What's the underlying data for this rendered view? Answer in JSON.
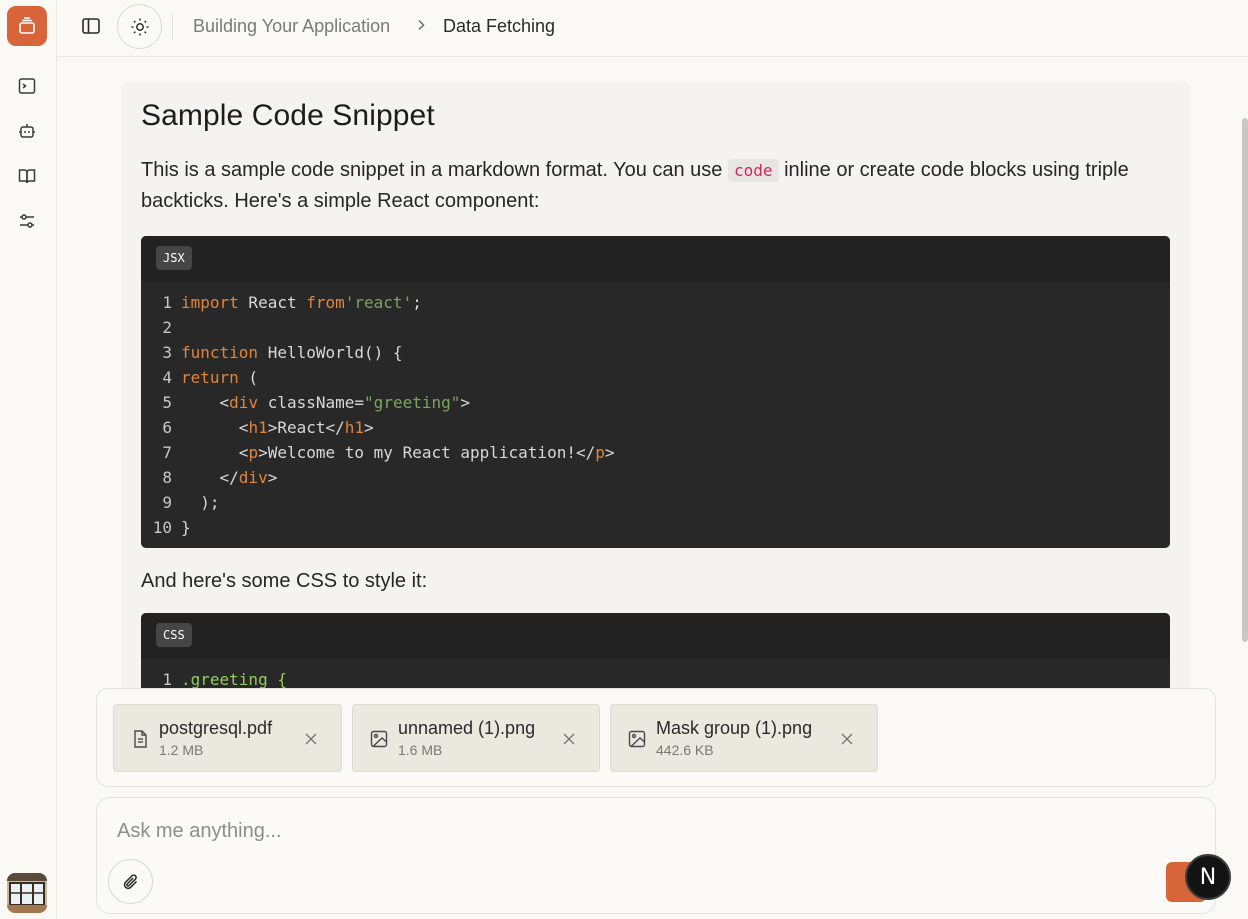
{
  "header": {
    "breadcrumb": [
      "Building Your Application",
      "Data Fetching"
    ]
  },
  "rail": {
    "items": [
      "terminal-icon",
      "bot-icon",
      "book-icon",
      "sliders-icon"
    ]
  },
  "card": {
    "title": "Sample Code Snippet",
    "intro_before": "This is a sample code snippet in a markdown format. You can use ",
    "inline_code": "code",
    "intro_after": " inline or create code blocks using triple backticks. Here's a simple React component:",
    "jsx_lang": "JSX",
    "middle_text": "And here's some CSS to style it:",
    "css_lang": "CSS",
    "css_first_line_number": "1",
    "css_first_line": ".greeting {"
  },
  "attachments": [
    {
      "name": "postgresql.pdf",
      "size": "1.2 MB",
      "icon": "file-text-icon"
    },
    {
      "name": "unnamed (1).png",
      "size": "1.6 MB",
      "icon": "image-icon"
    },
    {
      "name": "Mask group (1).png",
      "size": "442.6 KB",
      "icon": "image-icon"
    }
  ],
  "composer": {
    "placeholder": "Ask me anything...",
    "badge_letter": "N"
  },
  "colors": {
    "accent": "#d8643a",
    "code_bg": "#282828",
    "keyword": "#e2843a",
    "string": "#7aa65e",
    "inline_code": "#d6275a"
  }
}
